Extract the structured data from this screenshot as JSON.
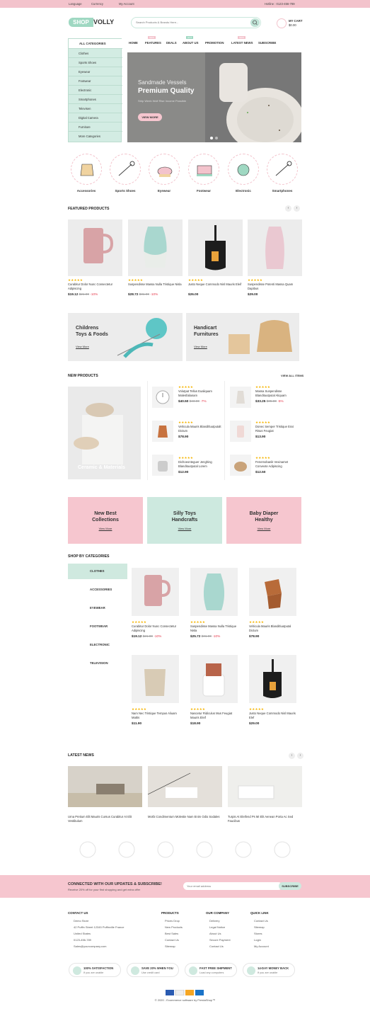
{
  "topbar": {
    "language": "Language",
    "currency": "Currency",
    "account": "My Account",
    "hotline": "Hotline : 0123-456-789"
  },
  "logo": {
    "part1": "SHOP",
    "part2": "VOLLY"
  },
  "search": {
    "placeholder": "Search Products & Brands Here..."
  },
  "cart": {
    "label": "MY CART",
    "amount": "$0.00"
  },
  "nav": {
    "items": [
      "HOME",
      "FEATURES",
      "DEALS",
      "ABOUT US",
      "PROMOTION",
      "LATEST NEWS",
      "SUBSCRIBE"
    ],
    "badges": [
      "NEW",
      "HOT"
    ]
  },
  "categories": {
    "title": "ALL CATEGORIES",
    "items": [
      "Clothes",
      "Sports Shoes",
      "Eyewear",
      "Footwear",
      "Electronic",
      "Smartphones",
      "Televisen",
      "Digital Camera",
      "Furniture",
      "More Categories"
    ]
  },
  "hero": {
    "line1": "Sandmade Vessels",
    "line2": "Premium Quality",
    "line3": "Strip Week Wolf Rise Income Possible",
    "button": "VIEW MORE"
  },
  "icons": {
    "items": [
      "Accessories",
      "Sports Shoes",
      "Eyewear",
      "Footwear",
      "Electronic",
      "Smartphones"
    ]
  },
  "featured": {
    "title": "FEATURED PRODUCTS",
    "products": [
      {
        "name": "Curabitur Dolor Nunc Consectetur Adipiscing",
        "price": "$19.12",
        "old": "$21.00",
        "disc": "-10%"
      },
      {
        "name": "Suspendisse Massa Nulla Tristique Nisla",
        "price": "$28.72",
        "old": "$31.00",
        "disc": "-10%"
      },
      {
        "name": "Justo Neque Commodo Nisl Mauris Eleif",
        "price": "$26.00",
        "old": "",
        "disc": ""
      },
      {
        "name": "Suspendisse Potenti Massa Quam Dapibus",
        "price": "$29.00",
        "old": "",
        "disc": ""
      }
    ]
  },
  "promo": {
    "b1a": "Childrens",
    "b1b": "Toys & Foods",
    "b1c": "View More",
    "b2a": "Handicart",
    "b2b": "Furnitures",
    "b2c": "View More"
  },
  "newp": {
    "title": "NEW PRODUCTS",
    "viewall": "VIEW ALL ITEMS",
    "big": "Ceramic & Materials",
    "items": [
      {
        "name": "Volutpat Tellus Eualiquam Malesfalianam",
        "price": "$40.50",
        "old": "$43.00",
        "disc": "-7%"
      },
      {
        "name": "Massa Suspendisse Blandituutputal Aliquam",
        "price": "$33.25",
        "old": "$35.00",
        "disc": "-5%"
      },
      {
        "name": "Vehicula Mauris Blanditluutputalt Dictum",
        "price": "$78.90",
        "old": "",
        "disc": ""
      },
      {
        "name": "Donec Semper Tristique Erat Risus Feugiat",
        "price": "$13.90",
        "old": "",
        "disc": ""
      },
      {
        "name": "Dichoeonteguer Jenghing Blandituutputal Lorem",
        "price": "$12.90",
        "old": "",
        "disc": ""
      },
      {
        "name": "Fenemobanik Vexinamet Convexte Adipiscing",
        "price": "$12.50",
        "old": "",
        "disc": ""
      }
    ]
  },
  "tiles": {
    "t1a": "New Best",
    "t1b": "Collections",
    "t2a": "Silly Toys",
    "t2b": "Handcrafts",
    "t3a": "Baby Diaper",
    "t3b": "Healthy",
    "more": "View More"
  },
  "shopcat": {
    "title": "SHOP BY CATEGORIES",
    "tabs": [
      "CLOTHES",
      "ACCESSORIES",
      "EYEWEAR",
      "FOOTWEAR",
      "ELECTRONIC",
      "TELEVISION"
    ],
    "products": [
      {
        "name": "Curabitur Dolor Nunc Consectetur Adipiscing",
        "price": "$19.12",
        "old": "$21.00",
        "disc": "-10%"
      },
      {
        "name": "Suspendisse Massa Nulla Tristique Nisla",
        "price": "$25.72",
        "old": "$31.00",
        "disc": "-10%"
      },
      {
        "name": "Vehicula Mauris Blanditluutputal Dictum",
        "price": "$78.90",
        "old": "",
        "disc": ""
      },
      {
        "name": "Nam Nec Tristique Tempus Aliuam Mattis",
        "price": "$11.90",
        "old": "",
        "disc": ""
      },
      {
        "name": "Nascetur Ridiculus Mus Feugiat Mauris Eleif",
        "price": "$18.90",
        "old": "",
        "disc": ""
      },
      {
        "name": "Justo Neque Commodo Nisl Mauris Elef",
        "price": "$29.00",
        "old": "",
        "disc": ""
      }
    ]
  },
  "news": {
    "title": "LATEST NEWS",
    "items": [
      "Urna Pretium Elit Mauris Cursus Curabitur At Elit Vestibulum",
      "Morbi Condimentum Molestie Nam Enim Odio Sodales",
      "Turpis At Eleifend Ps Mi Elit Aenean Porta Ac Sed Faucibus"
    ]
  },
  "newsletter": {
    "title": "CONNECTED WITH OUR UPDATES & SUBSCRIBE!",
    "sub": "Receive 20% off for your first shopping and get extra offer",
    "placeholder": "Your email address",
    "button": "SUBSCRIBE"
  },
  "footer": {
    "contact_title": "CONTACT US",
    "contact": [
      "Demo Store",
      "42 Puffin Street 12345 Puffinville France",
      "United States",
      "0123-456-789",
      "Sales@yourcompany.com"
    ],
    "products_title": "PRODUCTS",
    "products": [
      "Prices Drop",
      "New Products",
      "Best Sales",
      "Contact Us",
      "Sitemap"
    ],
    "company_title": "OUR COMPANY",
    "company": [
      "Delivery",
      "Legal Notice",
      "About Us",
      "Secure Payment",
      "Contact Us"
    ],
    "quick_title": "QUICK LINK",
    "quick": [
      "Contact Us",
      "Sitemap",
      "Stores",
      "Login",
      "My Account"
    ]
  },
  "badges": [
    {
      "t": "100% SATISFACTION",
      "s": "If you are unable"
    },
    {
      "t": "SAVE 20% WHEN YOU",
      "s": "Use credit card"
    },
    {
      "t": "FAST FREE SHIPMENT",
      "s": "Load any computers"
    },
    {
      "t": "14-DAY MONEY BACK",
      "s": "If you are unable"
    }
  ],
  "copyright": "© 2020 - Ecommerce software by PrestaShop™",
  "colors": {
    "pink": "#f6c6cf",
    "mint": "#cde9df",
    "accent_red": "#e5394c"
  }
}
